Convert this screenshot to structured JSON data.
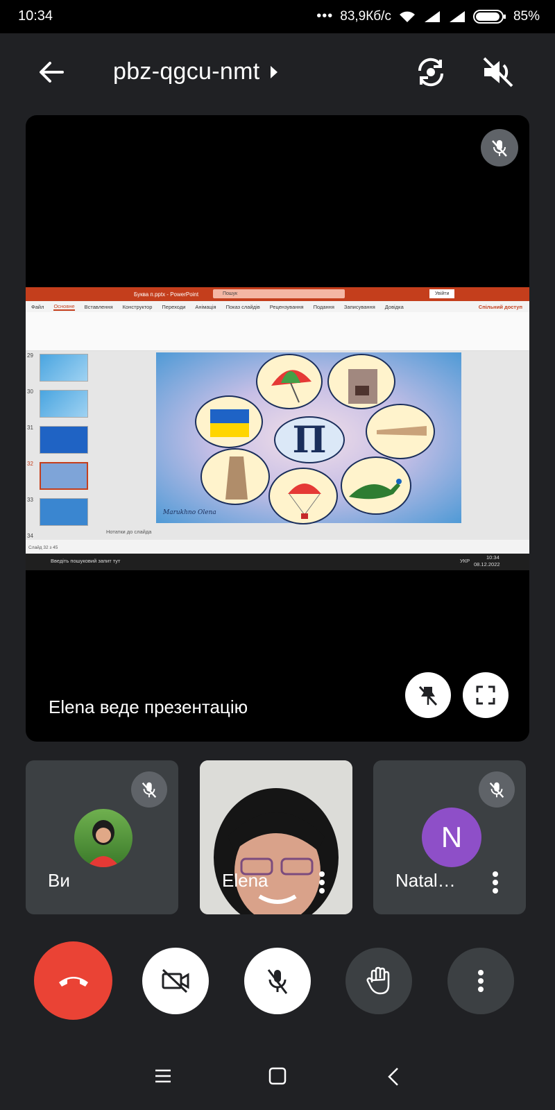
{
  "status_bar": {
    "time": "10:34",
    "speed": "83,9Кб/с",
    "battery": "85%"
  },
  "header": {
    "meeting_code": "pbz-qgcu-nmt"
  },
  "stage": {
    "presenting_text": "Elena веде презентацію",
    "share": {
      "window_title": "Буква п.pptx - PowerPoint",
      "search_placeholder": "Пошук",
      "signin_label": "Увійти",
      "share_label": "Спільний доступ",
      "tabs": [
        "Файл",
        "Основне",
        "Вставлення",
        "Конструктор",
        "Переходи",
        "Анімація",
        "Показ слайдів",
        "Рецензування",
        "Подання",
        "Записування",
        "Довідка"
      ],
      "active_tab": "Основне",
      "slide_numbers": [
        "29",
        "30",
        "31",
        "32",
        "33",
        "34"
      ],
      "slide_letter": "П",
      "signature": "Marukhno Olena",
      "notes_placeholder": "Нотатки до слайда",
      "statusline": "Слайд 32 з 45",
      "taskbar_search": "Введіть пошуковий запит тут",
      "taskbar_time": "10:34",
      "taskbar_date": "08.12.2022",
      "taskbar_lang": "УКР"
    }
  },
  "participants": [
    {
      "name": "Ви",
      "muted": true,
      "avatar": "photo"
    },
    {
      "name": "Elena",
      "muted": false,
      "avatar": "video"
    },
    {
      "name": "Natal…",
      "muted": true,
      "avatar_letter": "N",
      "avatar_color": "#8e4fc8"
    }
  ],
  "colors": {
    "end_call": "#ea4335",
    "control_dark": "#3c4043",
    "control_light": "#ffffff"
  }
}
